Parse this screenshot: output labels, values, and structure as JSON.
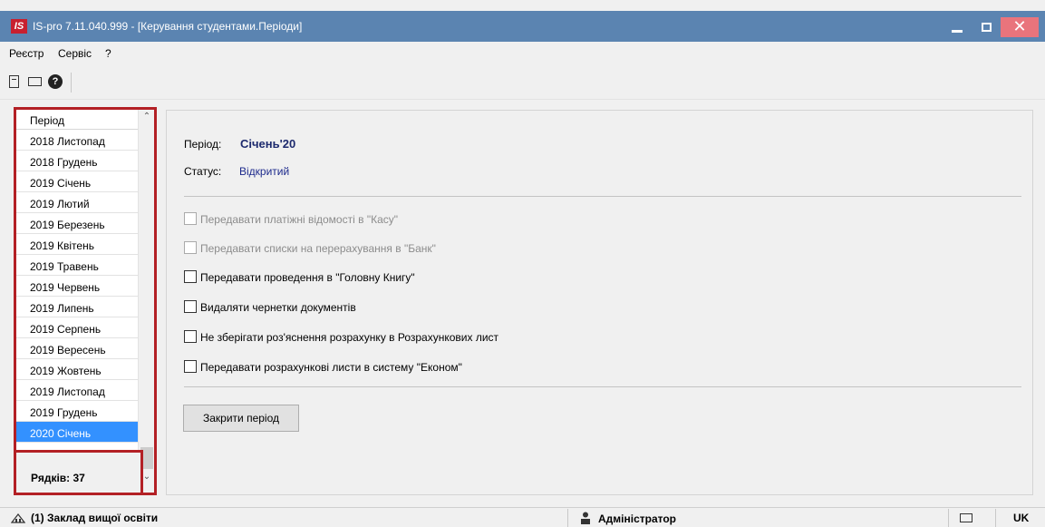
{
  "window": {
    "logo_text": "IS",
    "title": "IS-pro 7.11.040.999 - [Керування студентами.Періоди]"
  },
  "menu": {
    "items": [
      "Реєстр",
      "Сервіс",
      "?"
    ]
  },
  "toolbar": {
    "help_glyph": "?"
  },
  "period_list": {
    "header": "Період",
    "rows": [
      "2018 Листопад",
      "2018 Грудень",
      "2019 Січень",
      "2019 Лютий",
      "2019 Березень",
      "2019 Квітень",
      "2019 Травень",
      "2019 Червень",
      "2019 Липень",
      "2019 Серпень",
      "2019 Вересень",
      "2019 Жовтень",
      "2019 Листопад",
      "2019 Грудень",
      "2020 Січень"
    ],
    "selected": "2020 Січень",
    "footer": "Рядків: 37",
    "annotation": "1"
  },
  "details": {
    "period_label": "Період:",
    "period_value": "Січень'20",
    "status_label": "Статус:",
    "status_value": "Відкритий",
    "options": [
      {
        "label": "Передавати платіжні відомості в \"Касу\"",
        "disabled": true,
        "checked": false
      },
      {
        "label": "Передавати списки на перерахування в \"Банк\"",
        "disabled": true,
        "checked": false
      },
      {
        "label": "Передавати проведення в \"Головну Книгу\"",
        "disabled": false,
        "checked": false
      },
      {
        "label": "Видаляти чернетки документів",
        "disabled": false,
        "checked": false
      },
      {
        "label": "Не зберігати роз'яснення розрахунку в Розрахункових лист",
        "disabled": false,
        "checked": false
      },
      {
        "label": "Передавати розрахункові листи в систему \"Економ\"",
        "disabled": false,
        "checked": false
      }
    ],
    "close_period_button": "Закрити період"
  },
  "statusbar": {
    "organization": "(1) Заклад вищої освіти",
    "user": "Адміністратор",
    "language": "UK"
  },
  "colors": {
    "titlebar": "#5b84b1",
    "close_button": "#e9747c",
    "selection": "#3391ff",
    "highlight_frame": "#b32025",
    "value_text": "#1d2a8c"
  }
}
